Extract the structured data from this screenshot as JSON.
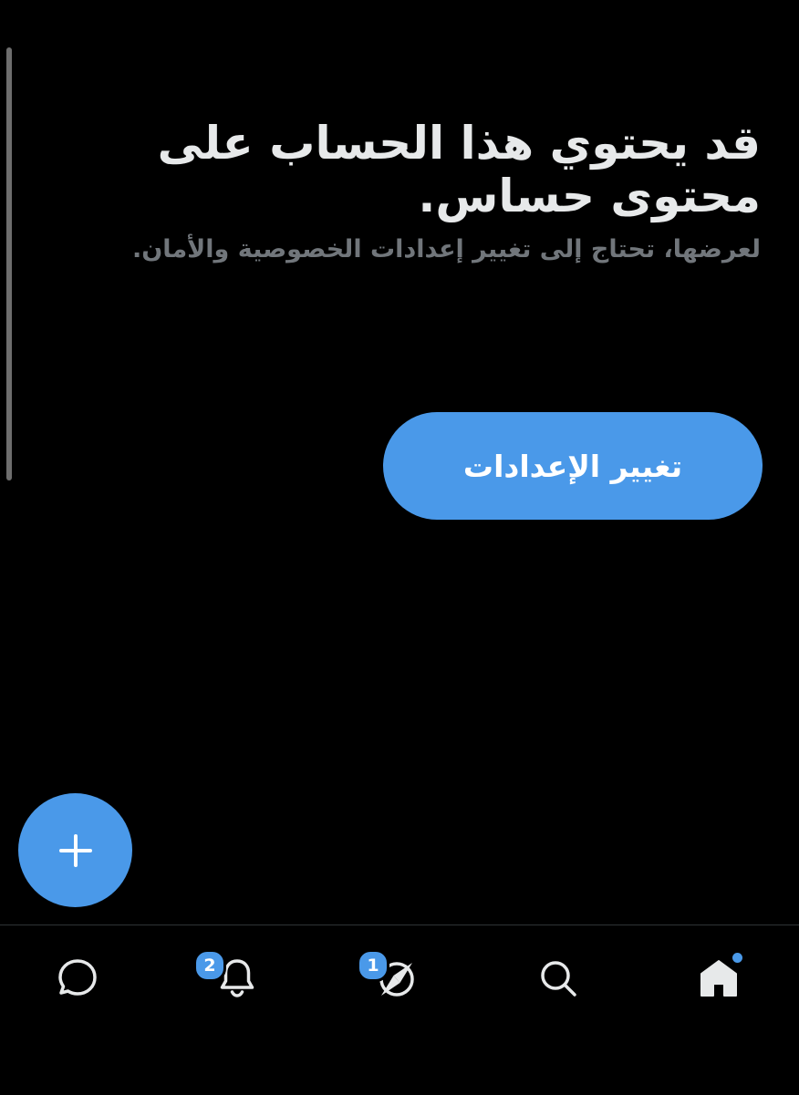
{
  "colors": {
    "background": "#000000",
    "accent": "#4a99e9",
    "primary_text": "#e7e9ea",
    "secondary_text": "#71767b"
  },
  "notice": {
    "title": "قد يحتوي هذا الحساب على محتوى حساس.",
    "subtitle": "لعرضها، تحتاج إلى تغيير إعدادات الخصوصية والأمان.",
    "button_label": "تغيير الإعدادات"
  },
  "fab": {
    "icon": "plus-icon"
  },
  "bottom_nav": {
    "items": [
      {
        "icon": "messages-icon"
      },
      {
        "icon": "bell-icon",
        "badge": "2"
      },
      {
        "icon": "explore-compass-icon",
        "badge": "1"
      },
      {
        "icon": "search-icon"
      },
      {
        "icon": "home-icon",
        "active": true
      }
    ]
  }
}
